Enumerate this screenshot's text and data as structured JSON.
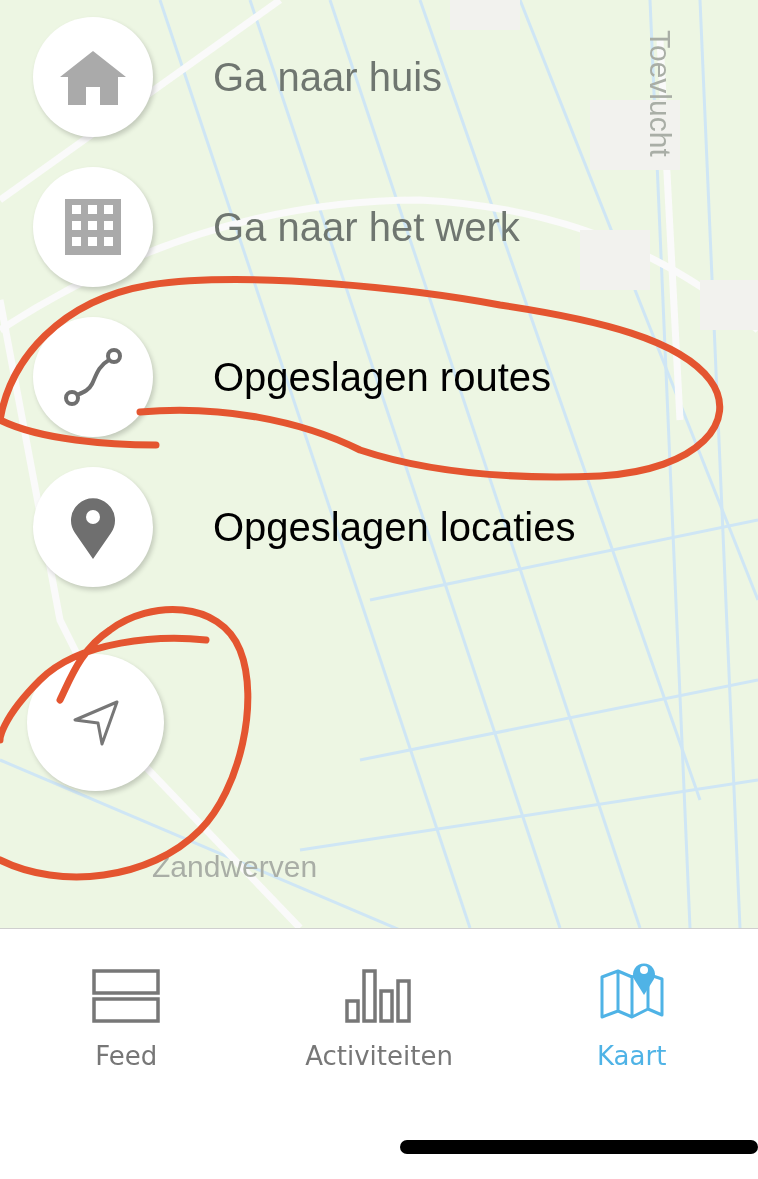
{
  "map": {
    "labels": [
      {
        "text": "Toevlucht",
        "kind": "vertical"
      },
      {
        "text": "Zandwerven",
        "kind": "horizontal"
      }
    ]
  },
  "menu": [
    {
      "kind": "home",
      "label": "Ga naar huis",
      "disabled": true
    },
    {
      "kind": "building",
      "label": "Ga naar het werk",
      "disabled": true
    },
    {
      "kind": "route",
      "label": "Opgeslagen routes",
      "disabled": false
    },
    {
      "kind": "pin",
      "label": "Opgeslagen locaties",
      "disabled": false
    }
  ],
  "tabs": [
    {
      "kind": "feed",
      "label": "Feed",
      "selected": false
    },
    {
      "kind": "activities",
      "label": "Activiteiten",
      "selected": false
    },
    {
      "kind": "map",
      "label": "Kaart",
      "selected": true
    }
  ]
}
